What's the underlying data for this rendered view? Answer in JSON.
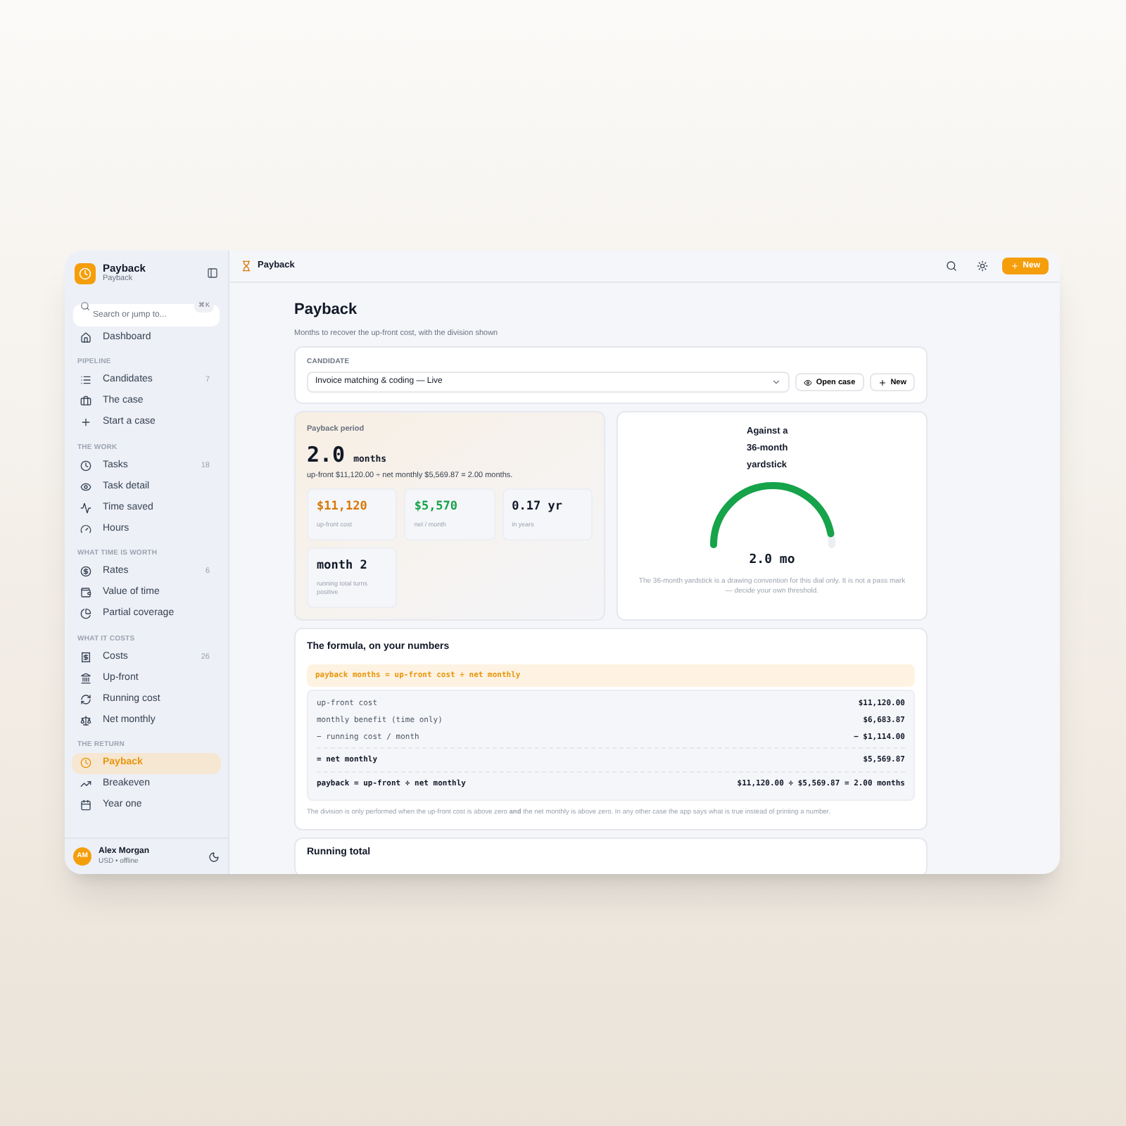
{
  "app": {
    "name": "Payback",
    "subtitle": "Payback"
  },
  "search": {
    "placeholder": "Search or jump to...",
    "shortcut": "⌘K"
  },
  "sidebar": {
    "top": [
      {
        "label": "Dashboard",
        "selected": false
      }
    ],
    "sections": [
      {
        "title": "PIPELINE",
        "items": [
          {
            "label": "Candidates",
            "count": "7",
            "selected": false
          },
          {
            "label": "The case",
            "selected": false
          },
          {
            "label": "Start a case",
            "selected": false
          }
        ]
      },
      {
        "title": "THE WORK",
        "items": [
          {
            "label": "Tasks",
            "count": "18",
            "selected": false
          },
          {
            "label": "Task detail",
            "selected": false
          },
          {
            "label": "Time saved",
            "selected": false
          },
          {
            "label": "Hours",
            "selected": false
          }
        ]
      },
      {
        "title": "WHAT TIME IS WORTH",
        "items": [
          {
            "label": "Rates",
            "count": "6",
            "selected": false
          },
          {
            "label": "Value of time",
            "selected": false
          },
          {
            "label": "Partial coverage",
            "selected": false
          }
        ]
      },
      {
        "title": "WHAT IT COSTS",
        "items": [
          {
            "label": "Costs",
            "count": "26",
            "selected": false
          },
          {
            "label": "Up-front",
            "selected": false
          },
          {
            "label": "Running cost",
            "selected": false
          },
          {
            "label": "Net monthly",
            "selected": false
          }
        ]
      },
      {
        "title": "THE RETURN",
        "items": [
          {
            "label": "Payback",
            "selected": true
          },
          {
            "label": "Breakeven",
            "selected": false
          },
          {
            "label": "Year one",
            "selected": false
          }
        ]
      }
    ]
  },
  "user": {
    "initials": "AM",
    "name": "Alex Morgan",
    "meta": "USD • offline"
  },
  "topbar": {
    "title": "Payback",
    "new_button": "New"
  },
  "page": {
    "title": "Payback",
    "subtitle": "Months to recover the up-front cost, with the division shown"
  },
  "candidate": {
    "label": "CANDIDATE",
    "value": "Invoice matching & coding — Live",
    "open_button": "Open case",
    "new_button": "New"
  },
  "period": {
    "label": "Payback period",
    "value": "2.0",
    "unit": "months",
    "equation": "up-front $11,120.00 ÷ net monthly $5,569.87 = 2.00 months.",
    "stats": [
      {
        "value": "$11,120",
        "caption": "up-front cost",
        "color": "#d97706"
      },
      {
        "value": "$5,570",
        "caption": "net / month",
        "color": "#16a34a"
      },
      {
        "value": "0.17 yr",
        "caption": "in years",
        "color": "#111827"
      },
      {
        "value": "month 2",
        "caption": "running total turns positive",
        "color": "#111827"
      }
    ]
  },
  "dial": {
    "title": "Against a 36-month yardstick",
    "level": 0.94,
    "reading": "2.0 mo",
    "note": "The 36-month yardstick is a drawing convention for this dial only. It is not a pass mark — decide your own threshold."
  },
  "formula": {
    "title": "The formula, on your numbers",
    "headline": "payback months = up-front cost ÷ net monthly",
    "rows": [
      {
        "label": "up-front cost",
        "value": "$11,120.00",
        "bold": false
      },
      {
        "label": "monthly benefit (time only)",
        "value": "$6,683.87",
        "bold": false
      },
      {
        "label": "− running cost / month",
        "value": "− $1,114.00",
        "bold": false
      },
      {
        "label": "= net monthly",
        "value": "$5,569.87",
        "bold": true
      },
      {
        "label": "payback = up-front ÷ net monthly",
        "value": "$11,120.00 ÷ $5,569.87 = 2.00 months",
        "bold": true
      }
    ],
    "note": "The division is only performed when the up-front cost is above zero **and** the net monthly is above zero. In any other case the app says what is true instead of printing a number."
  },
  "running_total": {
    "title": "Running total"
  }
}
